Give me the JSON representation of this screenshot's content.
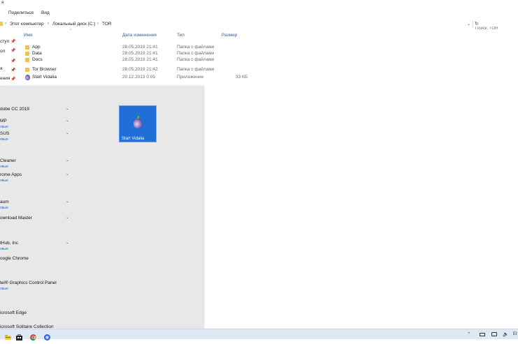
{
  "window": {
    "title_fragment": "я"
  },
  "ribbon": {
    "tabs": [
      "Поделиться",
      "Вид"
    ]
  },
  "address": {
    "crumbs": [
      "Этот компьютер",
      "Локальный диск (C:)",
      "TOR"
    ],
    "separator": "›",
    "search_placeholder": "Поиск: TOR"
  },
  "columns": {
    "name": "Имя",
    "date": "Дата изменения",
    "type": "Тип",
    "size": "Размер"
  },
  "nav_pane": [
    "ступ",
    "ол",
    "я",
    "ения"
  ],
  "files": [
    {
      "name": "App",
      "date": "28.05.2019 21:41",
      "type": "Папка с файлами",
      "size": "",
      "icon": "folder-icon"
    },
    {
      "name": "Data",
      "date": "28.05.2019 21:41",
      "type": "Папка с файлами",
      "size": "",
      "icon": "folder-icon"
    },
    {
      "name": "Docs",
      "date": "28.05.2019 21:41",
      "type": "Папка с файлами",
      "size": "",
      "icon": "folder-icon"
    },
    {
      "name": "Tor Browser",
      "date": "28.05.2019 21:42",
      "type": "Папка с файлами",
      "size": "",
      "icon": "folder-icon"
    },
    {
      "name": "Start Vidalia",
      "date": "20.12.2013 0:05",
      "type": "Приложение",
      "size": "33 КБ",
      "icon": "tor-onion-icon"
    }
  ],
  "start_menu": {
    "apps": [
      {
        "name": "dobe CC 2019",
        "badge": "",
        "expandable": true
      },
      {
        "name": "MP",
        "badge": "овые",
        "expandable": true
      },
      {
        "name": "SUS",
        "badge": "овые",
        "expandable": true
      },
      {
        "name": "Cleaner",
        "badge": "овые",
        "expandable": true
      },
      {
        "name": "rome Apps",
        "badge": "овые",
        "expandable": true
      },
      {
        "name": "aum",
        "badge": "овые",
        "expandable": true
      },
      {
        "name": "ownload Master",
        "badge": "",
        "expandable": true
      },
      {
        "name": "tHub, Inc",
        "badge": "овые",
        "expandable": true
      },
      {
        "name": "oogle Chrome",
        "badge": "",
        "expandable": false
      },
      {
        "name": "tel® Graphics Control Panel",
        "badge": "овые",
        "expandable": false
      },
      {
        "name": "icrosoft Edge",
        "badge": "",
        "expandable": false
      },
      {
        "name": "icrosoft Solitaire Collection",
        "badge": "",
        "expandable": false
      }
    ],
    "tile": {
      "label": "Start Vidalia",
      "icon": "tor-onion-icon",
      "color": "#1f6fd6"
    }
  },
  "taskbar": {
    "pinned": [
      "file-explorer-icon",
      "store-icon",
      "chrome-icon",
      "tor-browser-icon"
    ],
    "tray": [
      "chevron-up-icon",
      "battery-icon",
      "network-icon",
      "volume-icon"
    ],
    "lang": "EI"
  }
}
